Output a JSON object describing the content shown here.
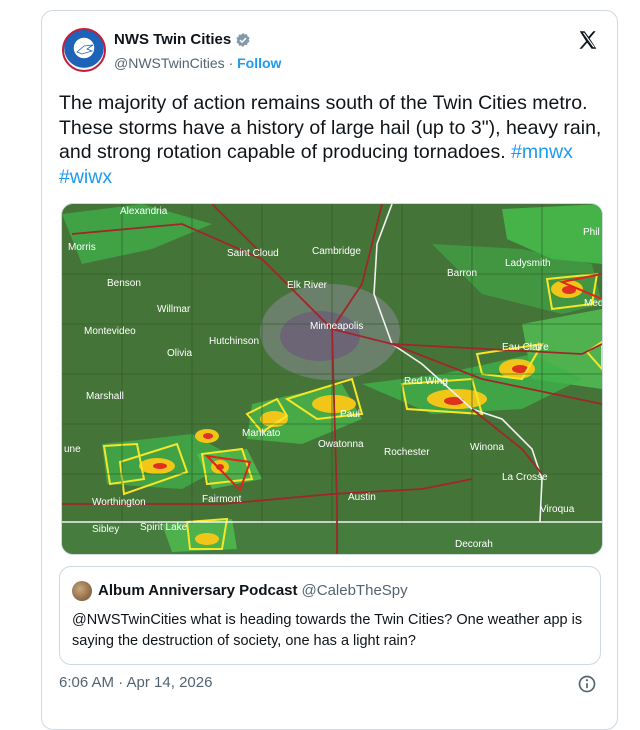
{
  "author": {
    "name": "NWS Twin Cities",
    "handle": "@NWSTwinCities",
    "separator": "·",
    "follow_label": "Follow"
  },
  "tweet": {
    "text": "The majority of action remains south of the Twin Cities metro. These storms have a history of large hail (up to 3\"), heavy rain, and strong rotation capable of producing tornadoes.",
    "hashtags": [
      "#mnwx",
      "#wiwx"
    ]
  },
  "map": {
    "places": [
      "Alexandria",
      "Morris",
      "Saint Cloud",
      "Cambridge",
      "Barron",
      "Ladysmith",
      "Benson",
      "Elk River",
      "Willmar",
      "Minneapolis",
      "Montevideo",
      "Hutchinson",
      "Olivia",
      "Red Wing",
      "Eau Claire",
      "Marshall",
      "Mankato",
      "Owatonna",
      "Rochester",
      "Winona",
      "La Crosse",
      "Worthington",
      "Fairmont",
      "Austin",
      "Viroqua",
      "Sibley",
      "Spirit Lake",
      "Decorah",
      "Phil",
      "Med",
      "Paul",
      "une"
    ]
  },
  "quote": {
    "name": "Album Anniversary Podcast",
    "handle": "@CalebTheSpy",
    "text": "@NWSTwinCities what is heading towards the Twin Cities? One weather app is saying the destruction of society, one has a light rain?"
  },
  "timestamp": "6:06 AM · Apr 14, 2026"
}
